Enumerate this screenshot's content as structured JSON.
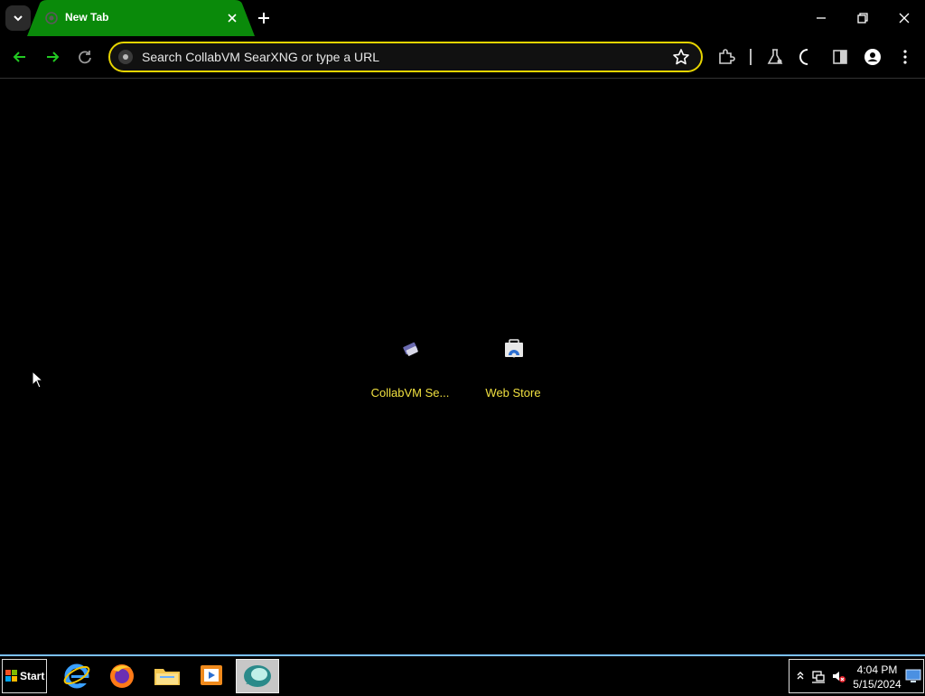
{
  "browser": {
    "tab": {
      "title": "New Tab"
    },
    "omnibox": {
      "placeholder": "Search CollabVM SearXNG or type a URL"
    }
  },
  "shortcuts": [
    {
      "label": "CollabVM Se..."
    },
    {
      "label": "Web Store"
    }
  ],
  "taskbar": {
    "start_label": "Start",
    "clock": {
      "time": "4:04 PM",
      "date": "5/15/2024"
    }
  },
  "colors": {
    "tab_active": "#0a8a0a",
    "accent_green": "#22c922",
    "omnibox_border": "#e6d400",
    "shortcut_text": "#f0e040",
    "taskbar_border": "#7ac0ff"
  }
}
